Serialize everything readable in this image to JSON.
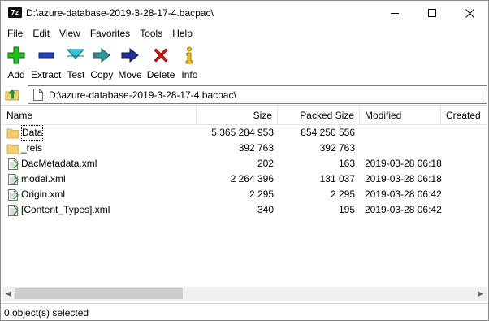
{
  "window": {
    "title": "D:\\azure-database-2019-3-28-17-4.bacpac\\",
    "app_icon_text": "7z"
  },
  "menu": {
    "items": [
      "File",
      "Edit",
      "View",
      "Favorites",
      "Tools",
      "Help"
    ]
  },
  "toolbar": {
    "buttons": [
      {
        "label": "Add",
        "icon": "add-icon",
        "color": "#1db31d"
      },
      {
        "label": "Extract",
        "icon": "extract-icon",
        "color": "#1f3fbf"
      },
      {
        "label": "Test",
        "icon": "test-icon",
        "color": "#19b9c9"
      },
      {
        "label": "Copy",
        "icon": "copy-icon",
        "color": "#1f8a8a"
      },
      {
        "label": "Move",
        "icon": "move-icon",
        "color": "#1f2f9f"
      },
      {
        "label": "Delete",
        "icon": "delete-icon",
        "color": "#e01010"
      },
      {
        "label": "Info",
        "icon": "info-icon",
        "color": "#e0b800"
      }
    ]
  },
  "address": {
    "value": "D:\\azure-database-2019-3-28-17-4.bacpac\\"
  },
  "columns": {
    "name": "Name",
    "size": "Size",
    "packed": "Packed Size",
    "modified": "Modified",
    "created": "Created"
  },
  "files": [
    {
      "name": "Data",
      "type": "folder",
      "size": "5 365 284 953",
      "packed": "854 250 556",
      "modified": ""
    },
    {
      "name": "_rels",
      "type": "folder",
      "size": "392 763",
      "packed": "392 763",
      "modified": ""
    },
    {
      "name": "DacMetadata.xml",
      "type": "xml",
      "size": "202",
      "packed": "163",
      "modified": "2019-03-28 06:18"
    },
    {
      "name": "model.xml",
      "type": "xml",
      "size": "2 264 396",
      "packed": "131 037",
      "modified": "2019-03-28 06:18"
    },
    {
      "name": "Origin.xml",
      "type": "xml",
      "size": "2 295",
      "packed": "2 295",
      "modified": "2019-03-28 06:42"
    },
    {
      "name": "[Content_Types].xml",
      "type": "xml",
      "size": "340",
      "packed": "195",
      "modified": "2019-03-28 06:42"
    }
  ],
  "status": {
    "text": "0 object(s) selected"
  }
}
